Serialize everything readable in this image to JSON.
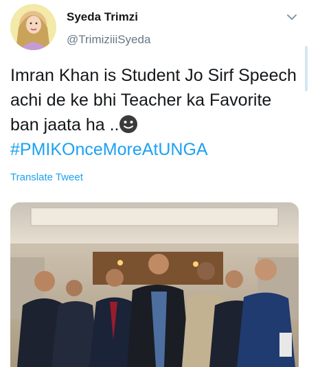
{
  "author": {
    "name": "Syeda Trimzi",
    "handle": "@TrimiziiiSyeda"
  },
  "tweet": {
    "text": "Imran Khan is Student Jo Sirf Speech achi de ke bhi Teacher ka Favorite ban jaata ha ..",
    "emoji": "smiling-face-emoji",
    "hashtag": "#PMIKOnceMoreAtUNGA",
    "translate_label": "Translate Tweet"
  },
  "icons": {
    "menu": "chevron-down-icon"
  },
  "colors": {
    "link": "#1da1f2",
    "text": "#14171a",
    "secondary": "#657786"
  }
}
